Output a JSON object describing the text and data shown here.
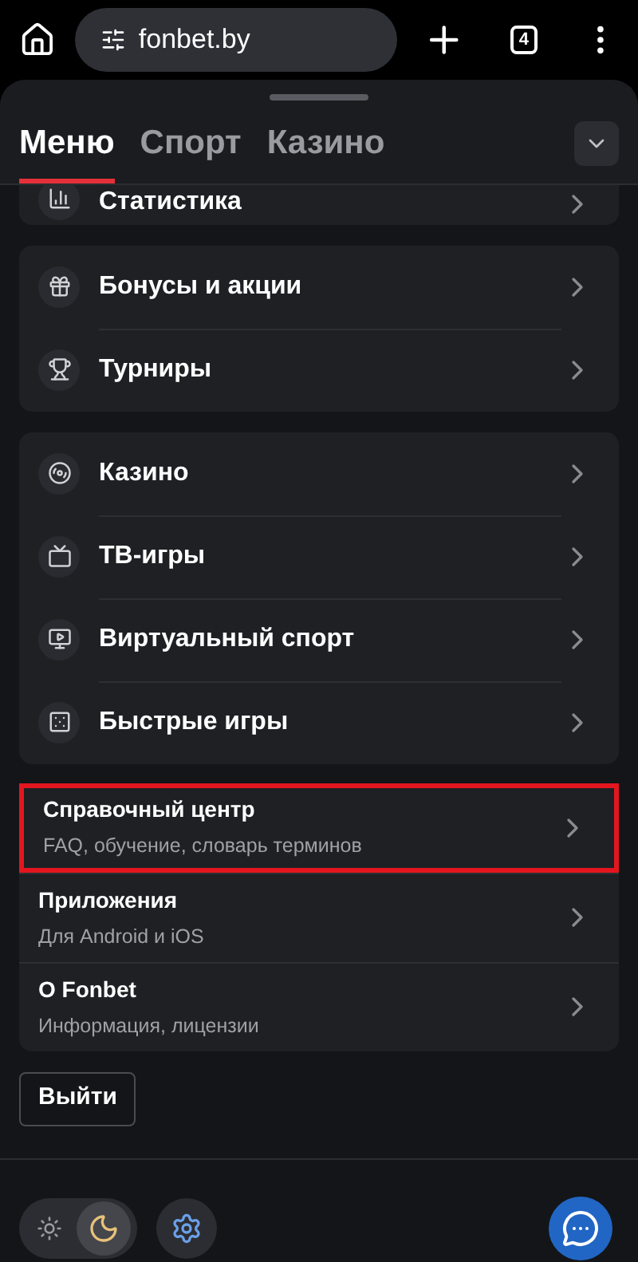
{
  "browser": {
    "url": "fonbet.by",
    "tab_count": "4"
  },
  "tabs": [
    {
      "label": "Меню",
      "selected": true
    },
    {
      "label": "Спорт",
      "selected": false
    },
    {
      "label": "Казино",
      "selected": false
    }
  ],
  "groups": [
    {
      "items": [
        {
          "label": "Статистика"
        }
      ]
    },
    {
      "items": [
        {
          "label": "Бонусы и акции"
        },
        {
          "label": "Турниры"
        }
      ]
    },
    {
      "items": [
        {
          "label": "Казино"
        },
        {
          "label": "ТВ-игры"
        },
        {
          "label": "Виртуальный спорт"
        },
        {
          "label": "Быстрые игры"
        }
      ]
    }
  ],
  "info_items": [
    {
      "title": "Справочный центр",
      "subtitle": "FAQ, обучение, словарь терминов",
      "highlighted": true
    },
    {
      "title": "Приложения",
      "subtitle": "Для Android и iOS",
      "highlighted": false
    },
    {
      "title": "О Fonbet",
      "subtitle": "Информация, лицензии",
      "highlighted": false
    }
  ],
  "logout": "Выйти",
  "theme": {
    "dark": true
  }
}
